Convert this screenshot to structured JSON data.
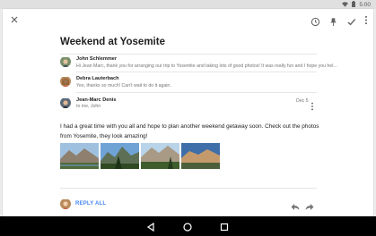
{
  "statusbar": {
    "time": "5:00"
  },
  "toolbar": {
    "close_icon": "close-icon",
    "icons": [
      "clock-icon",
      "pin-icon",
      "check-icon",
      "overflow-icon"
    ]
  },
  "thread": {
    "subject": "Weekend at Yosemite",
    "messages": [
      {
        "sender": "John Schlemmer",
        "snippet": "Hi Jean Marc, thank you for arranging our trip to Yosemite and taking lots of good photos! It was really fun and I hope you hel..."
      },
      {
        "sender": "Debra Lauterbach",
        "snippet": "Yes, thanks so much! Can't wait to do it again."
      },
      {
        "sender": "Jean-Marc Denis",
        "recipients": "to me, John",
        "date": "Dec 5"
      }
    ],
    "body": "I had a great time with you all and hope to plan another weekend getaway soon. Check out the photos from Yosemite, they look amazing!"
  },
  "actions": {
    "reply_all": "REPLY ALL"
  },
  "colors": {
    "accent": "#4285f4",
    "navbar": "#000000"
  }
}
